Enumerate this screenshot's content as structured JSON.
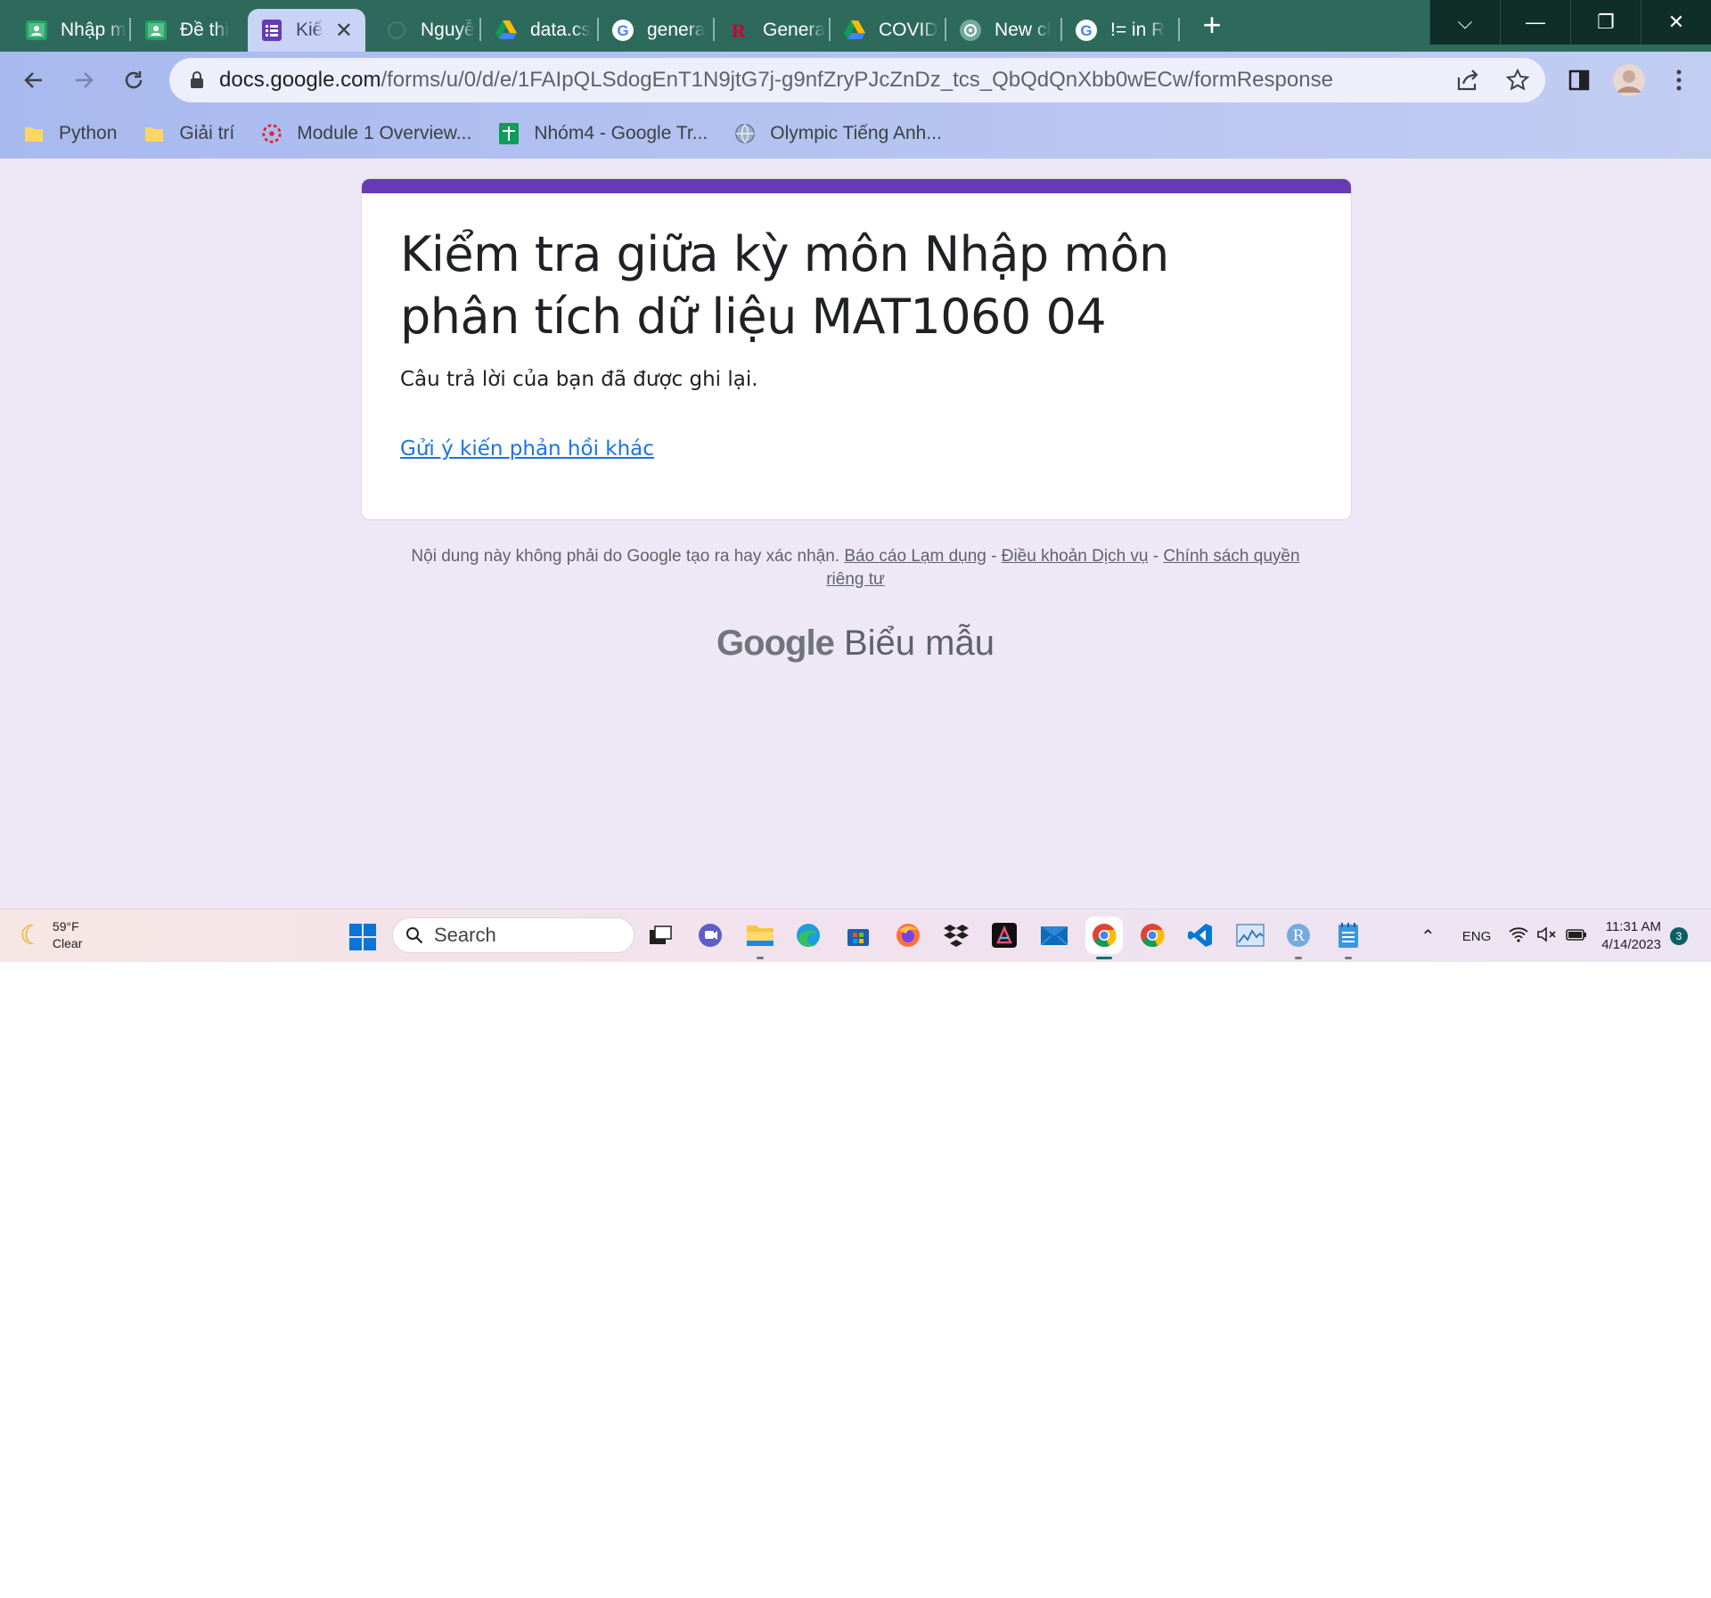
{
  "tabs": [
    {
      "title": "Nhập m",
      "icon": "classroom-icon"
    },
    {
      "title": "Đề thi",
      "icon": "classroom-icon"
    },
    {
      "title": "Kiể",
      "icon": "forms-icon",
      "active": true
    },
    {
      "title": "Nguyễ",
      "icon": "blank-page-icon"
    },
    {
      "title": "data.cs",
      "icon": "drive-icon"
    },
    {
      "title": "genera",
      "icon": "google-icon"
    },
    {
      "title": "Genera",
      "icon": "rutgers-icon"
    },
    {
      "title": "COVID",
      "icon": "drive-icon"
    },
    {
      "title": "New cl",
      "icon": "openai-icon"
    },
    {
      "title": "!= in R",
      "icon": "google-icon"
    }
  ],
  "address": {
    "host": "docs.google.com",
    "path": "/forms/u/0/d/e/1FAIpQLSdogEnT1N9jtG7j-g9nfZryPJcZnDz_tcs_QbQdQnXbb0wECw/formResponse"
  },
  "bookmarks": [
    {
      "label": "Python",
      "icon": "folder-icon"
    },
    {
      "label": "Giải trí",
      "icon": "folder-icon"
    },
    {
      "label": "Module 1 Overview...",
      "icon": "canvas-icon"
    },
    {
      "label": "Nhóm4 - Google Tr...",
      "icon": "sheets-icon"
    },
    {
      "label": "Olympic Tiếng Anh...",
      "icon": "globe-icon"
    }
  ],
  "form": {
    "title": "Kiểm tra giữa kỳ môn Nhập môn phân tích dữ liệu MAT1060 04",
    "confirmation": "Câu trả lời của bạn đã được ghi lại.",
    "another_response_link": "Gửi ý kiến phản hồi khác"
  },
  "footer": {
    "disclaimer": "Nội dung này không phải do Google tạo ra hay xác nhận.",
    "report_abuse": "Báo cáo Lạm dụng",
    "terms": "Điều khoản Dịch vụ",
    "privacy": "Chính sách quyền riêng tư",
    "separator": " - ",
    "brand_google": "Google",
    "brand_product": "Biểu mẫu"
  },
  "taskbar": {
    "temperature": "59°F",
    "condition": "Clear",
    "search_placeholder": "Search",
    "language": "ENG",
    "time": "11:31 AM",
    "date": "4/14/2023",
    "notification_count": "3",
    "apps": [
      "task-view-icon",
      "chat-icon",
      "file-explorer-icon",
      "edge-icon",
      "store-icon",
      "firefox-icon",
      "dropbox-icon",
      "affinity-icon",
      "mail-icon",
      "chrome-icon",
      "chrome-alt-icon",
      "vscode-icon",
      "perfmon-icon",
      "r-icon",
      "notepad-icon"
    ]
  },
  "colors": {
    "form_accent": "#673ab7",
    "page_background": "#ede7f6",
    "link": "#1a73e8",
    "tabstrip": "#2e6a5c"
  }
}
